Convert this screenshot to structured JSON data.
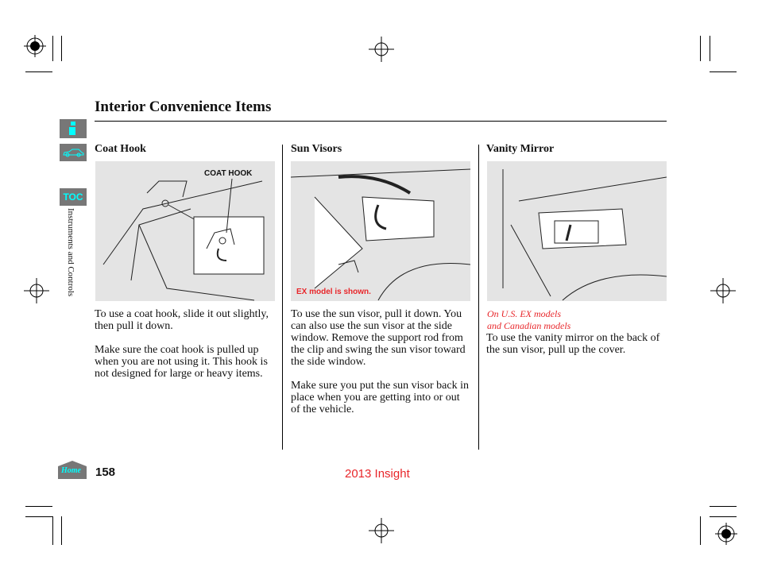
{
  "header": {
    "title": "Interior Convenience Items"
  },
  "sidebar": {
    "info_icon": "info-icon",
    "car_icon": "car-icon",
    "toc_label": "TOC",
    "section_label": "Instruments and Controls"
  },
  "columns": [
    {
      "heading": "Coat Hook",
      "figure_label": "COAT HOOK",
      "paragraphs": [
        "To use a coat hook, slide it out slightly, then pull it down.",
        "Make sure the coat hook is pulled up when you are not using it. This hook is not designed for large or heavy items."
      ]
    },
    {
      "heading": "Sun Visors",
      "figure_caption": "EX model is shown.",
      "paragraphs": [
        "To use the sun visor, pull it down. You can also use the sun visor at the side window. Remove the support rod from the clip and swing the sun visor toward the side window.",
        "Make sure you put the sun visor back in place when you are getting into or out of the vehicle."
      ]
    },
    {
      "heading": "Vanity Mirror",
      "note_line1": "On U.S. EX models",
      "note_line2": "and Canadian models",
      "paragraphs": [
        "To use the vanity mirror on the back of the sun visor, pull up the cover."
      ]
    }
  ],
  "footer": {
    "home_label": "Home",
    "page_number": "158",
    "model": "2013 Insight"
  },
  "colors": {
    "accent": "#e8262a",
    "icon_cyan": "#00ffff",
    "icon_bg": "#777777"
  }
}
